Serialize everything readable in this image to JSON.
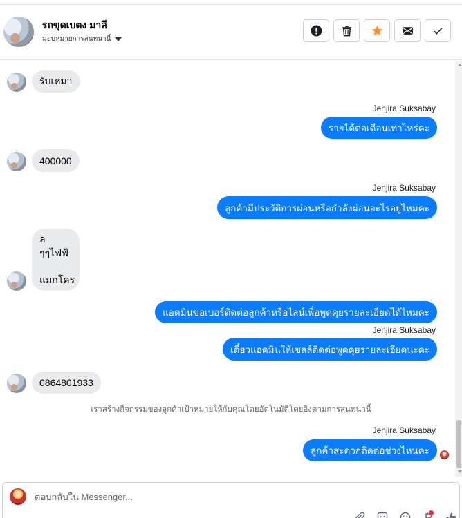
{
  "header": {
    "contact_name": "รถขุดเบตง มาลี",
    "assign_label": "มอบหมายการสนทนานี้",
    "actions": [
      {
        "name": "report-button",
        "icon": "alert-circle-icon"
      },
      {
        "name": "delete-button",
        "icon": "trash-icon"
      },
      {
        "name": "star-button",
        "icon": "star-icon"
      },
      {
        "name": "mark-unread-button",
        "icon": "envelope-icon"
      },
      {
        "name": "done-button",
        "icon": "check-icon"
      }
    ]
  },
  "thread": {
    "messages": [
      {
        "direction": "in",
        "text": "รับเหมา"
      },
      {
        "direction": "out",
        "sender": "Jenjira Suksabay",
        "text": "รายได้ต่อเดือนเท่าไหร่คะ"
      },
      {
        "direction": "in",
        "text": "400000"
      },
      {
        "direction": "out",
        "sender": "Jenjira Suksabay",
        "text": "ลูกค้ามีประวัติการผ่อนหรือกำลังผ่อนอะไรอยู่ไหมคะ"
      },
      {
        "direction": "in",
        "lines": [
          "ล",
          "ๆๆไฟฟ้",
          "",
          "แมกโคร"
        ]
      },
      {
        "direction": "out",
        "text": "แอดมินขอเบอร์ติดต่อลูกค้าหรือไลน์เพื่อพูดคุยรายละเอียดได้ไหมคะ"
      },
      {
        "direction": "out",
        "sender": "Jenjira Suksabay",
        "text": "เดี๋ยวแอดมินให้เซลล์ติดต่อพูดคุยรายละเอียดนะคะ"
      },
      {
        "direction": "in",
        "text": "0864801933"
      },
      {
        "direction": "out",
        "sender": "Jenjira Suksabay",
        "text": "ลูกค้าสะดวกติดต่อช่วงไหนคะ"
      }
    ],
    "system_note": "เราสร้างกิจกรรมของลูกค้าเป้าหมายให้กับคุณโดยอัตโนมัติโดยอิงตามการสนทนานี้"
  },
  "composer": {
    "placeholder": "ตอบกลับใน Messenger..."
  },
  "colors": {
    "outgoing_bubble": "#0a7cff",
    "incoming_bubble": "#e9eaec",
    "star": "#f7923b"
  }
}
